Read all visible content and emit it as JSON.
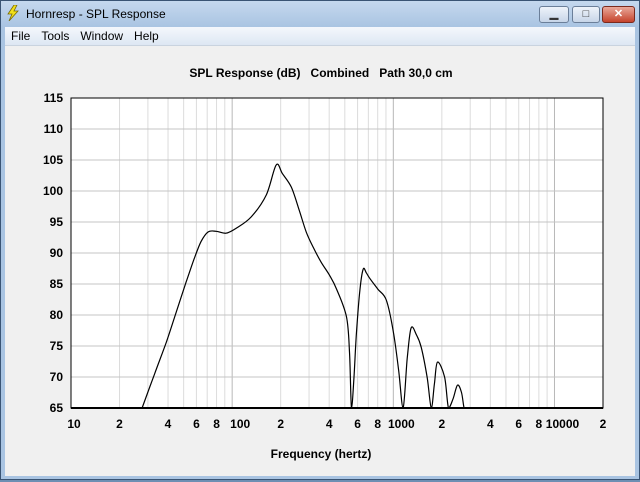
{
  "window": {
    "title": "Hornresp - SPL Response",
    "minimize": "▁",
    "maximize": "□",
    "close": "✕",
    "icon": "lightning-icon"
  },
  "menu": [
    "File",
    "Tools",
    "Window",
    "Help"
  ],
  "chart_data": {
    "type": "line",
    "title": "SPL Response (dB)   Combined   Path 30,0 cm",
    "xlabel": "Frequency (hertz)",
    "ylabel": "",
    "xscale": "log",
    "xlim": [
      10,
      20000
    ],
    "ylim": [
      65,
      115
    ],
    "yticks": [
      115,
      110,
      105,
      100,
      95,
      90,
      85,
      80,
      75,
      70,
      65
    ],
    "xticks": [
      {
        "value": 10,
        "label": "10"
      },
      {
        "value": 20,
        "label": "2"
      },
      {
        "value": 40,
        "label": "4"
      },
      {
        "value": 60,
        "label": "6"
      },
      {
        "value": 80,
        "label": "8"
      },
      {
        "value": 100,
        "label": "100"
      },
      {
        "value": 200,
        "label": "2"
      },
      {
        "value": 400,
        "label": "4"
      },
      {
        "value": 600,
        "label": "6"
      },
      {
        "value": 800,
        "label": "8"
      },
      {
        "value": 1000,
        "label": "1000"
      },
      {
        "value": 2000,
        "label": "2"
      },
      {
        "value": 4000,
        "label": "4"
      },
      {
        "value": 6000,
        "label": "6"
      },
      {
        "value": 8000,
        "label": "8"
      },
      {
        "value": 10000,
        "label": "10000"
      },
      {
        "value": 20000,
        "label": "2"
      }
    ],
    "grid": true,
    "series": [
      {
        "name": "SPL",
        "color": "#000000",
        "x": [
          27.6,
          33,
          39,
          45,
          51.8,
          58,
          64,
          71,
          79.6,
          91.6,
          106,
          131,
          163,
          187.5,
          205,
          233,
          260,
          288,
          320,
          357,
          400,
          444,
          512,
          535,
          550,
          570,
          590,
          620,
          650,
          680,
          710,
          800,
          905,
          1000,
          1080,
          1150,
          1220,
          1290,
          1390,
          1490,
          1620,
          1720,
          1800,
          1880,
          2080,
          2200,
          2350,
          2500,
          2650,
          2750,
          2850
        ],
        "y": [
          65,
          70.5,
          75.6,
          80.5,
          85.3,
          89,
          91.8,
          93.4,
          93.5,
          93.2,
          94,
          95.8,
          99.4,
          104.2,
          102.8,
          100.6,
          97,
          93.4,
          90.8,
          88.5,
          86.5,
          84.2,
          79.7,
          74,
          65,
          70,
          77,
          84,
          87.4,
          86.8,
          86,
          84.2,
          82.4,
          77.3,
          71,
          65,
          73,
          77.9,
          76.8,
          74.8,
          70,
          65,
          69,
          72.4,
          70,
          65,
          66.5,
          68.7,
          67.5,
          65,
          65
        ]
      }
    ]
  }
}
